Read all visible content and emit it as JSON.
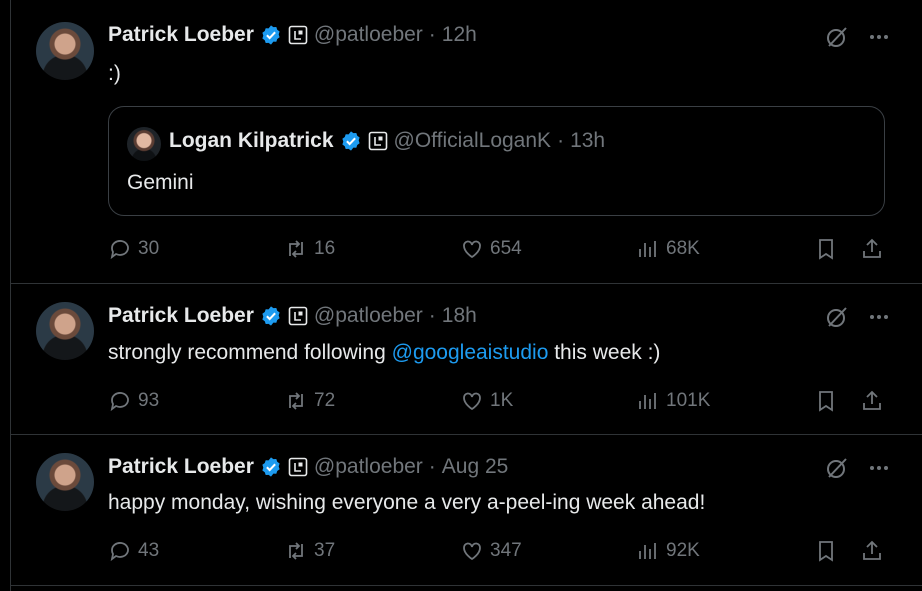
{
  "tweets": [
    {
      "author": "Patrick Loeber",
      "handle": "@patloeber",
      "time": "12h",
      "text": ":)",
      "quote": {
        "author": "Logan Kilpatrick",
        "handle": "@OfficialLoganK",
        "time": "13h",
        "text": "Gemini"
      },
      "replies": "30",
      "retweets": "16",
      "likes": "654",
      "views": "68K"
    },
    {
      "author": "Patrick Loeber",
      "handle": "@patloeber",
      "time": "18h",
      "text_before": "strongly recommend following ",
      "mention": "@googleaistudio",
      "text_after": " this week :)",
      "replies": "93",
      "retweets": "72",
      "likes": "1K",
      "views": "101K"
    },
    {
      "author": "Patrick Loeber",
      "handle": "@patloeber",
      "time": "Aug 25",
      "text": "happy monday, wishing everyone a very a-peel-ing week ahead!",
      "replies": "43",
      "retweets": "37",
      "likes": "347",
      "views": "92K"
    }
  ],
  "sep": "·",
  "colors": {
    "background": "#000000",
    "accent": "#1d9bf0",
    "muted": "#71767b",
    "text": "#e7e9ea",
    "border": "#2f3336"
  },
  "icons": [
    "verified-icon",
    "affiliate-icon",
    "grok-icon",
    "more-icon",
    "reply-icon",
    "retweet-icon",
    "like-icon",
    "views-icon",
    "bookmark-icon",
    "share-icon"
  ]
}
